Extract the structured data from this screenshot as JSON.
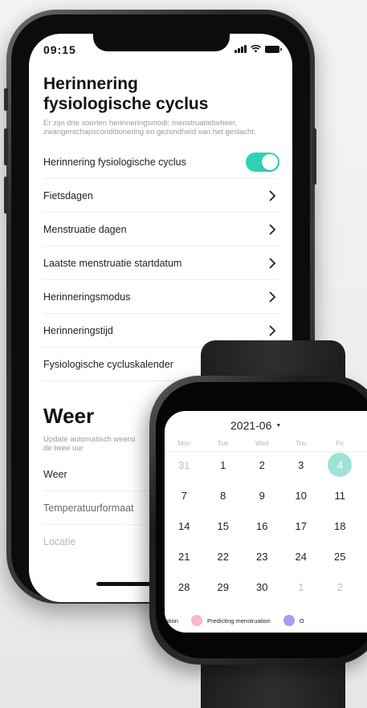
{
  "status_bar": {
    "time": "09:15"
  },
  "cycle_section": {
    "title_line1": "Herinnering",
    "title_line2": "fysiologische cyclus",
    "description": "Er zijn drie soorten herinneringsmodi: menstruatiebeheer, zwangerschapsconditionering en gezondheid van het geslacht.",
    "items": [
      {
        "label": "Herinnering fysiologische cyclus",
        "control": "toggle",
        "toggle_on": true
      },
      {
        "label": "Fietsdagen",
        "control": "chevron"
      },
      {
        "label": "Menstruatie dagen",
        "control": "chevron"
      },
      {
        "label": "Laatste menstruatie startdatum",
        "control": "chevron"
      },
      {
        "label": "Herinneringsmodus",
        "control": "chevron"
      },
      {
        "label": "Herinneringstijd",
        "control": "chevron"
      },
      {
        "label": "Fysiologische cycluskalender",
        "control": "chevron"
      }
    ]
  },
  "weather_section": {
    "title": "Weer",
    "description_line1": "Update automatisch weersi",
    "description_line2": "de twee uur",
    "items": [
      {
        "label": "Weer"
      },
      {
        "label": "Temperatuurformaat"
      },
      {
        "label": "Locatie"
      }
    ]
  },
  "watch_calendar": {
    "month": "2021-06",
    "weekdays": [
      "Mon",
      "Tue",
      "Wed",
      "Thu",
      "Fri"
    ],
    "weeks": [
      [
        "31",
        "1",
        "2",
        "3",
        "4"
      ],
      [
        "7",
        "8",
        "9",
        "10",
        "11"
      ],
      [
        "14",
        "15",
        "16",
        "17",
        "18"
      ],
      [
        "21",
        "22",
        "23",
        "24",
        "25"
      ],
      [
        "28",
        "29",
        "30",
        "1",
        "2"
      ]
    ],
    "selected_day": "4",
    "legend": [
      {
        "label": "ruation",
        "color": null
      },
      {
        "label": "Predicting menstruation",
        "color": "#f7b8c8"
      },
      {
        "label": "O",
        "color": "#a99bf0"
      }
    ]
  },
  "colors": {
    "accent_teal": "#2ed3b7",
    "selected_day": "#9fe3d8",
    "predicting_pink": "#f7b8c8",
    "ovulation_purple": "#a99bf0"
  }
}
